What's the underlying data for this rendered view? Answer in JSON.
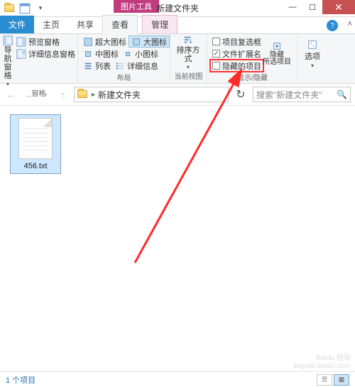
{
  "titlebar": {
    "contextual_label": "图片工具",
    "window_title": "新建文件夹"
  },
  "tabs": {
    "file": "文件",
    "home": "主页",
    "share": "共享",
    "view": "查看",
    "manage": "管理"
  },
  "ribbon": {
    "panes_group": "窗格",
    "nav_pane": "导航窗格",
    "preview_pane": "预览窗格",
    "details_pane": "详细信息窗格",
    "layout_group": "布局",
    "extra_large": "超大图标",
    "large": "大图标",
    "medium": "中图标",
    "small": "小图标",
    "list": "列表",
    "details": "详细信息",
    "current_view_group": "当前视图",
    "sort_by": "排序方式",
    "show_hide_group": "显示/隐藏",
    "item_checkboxes": "项目复选框",
    "file_ext": "文件扩展名",
    "hidden_items": "隐藏的项目",
    "hide_selected": "隐藏\n所选项目",
    "options": "选项"
  },
  "addr": {
    "location": "新建文件夹",
    "search_placeholder": "搜索\"新建文件夹\""
  },
  "content": {
    "file_name": "456.txt"
  },
  "status": {
    "count": "1 个项目"
  },
  "watermark": {
    "line1": "Baidu 经验",
    "line2": "jingyan.baidu.com"
  }
}
